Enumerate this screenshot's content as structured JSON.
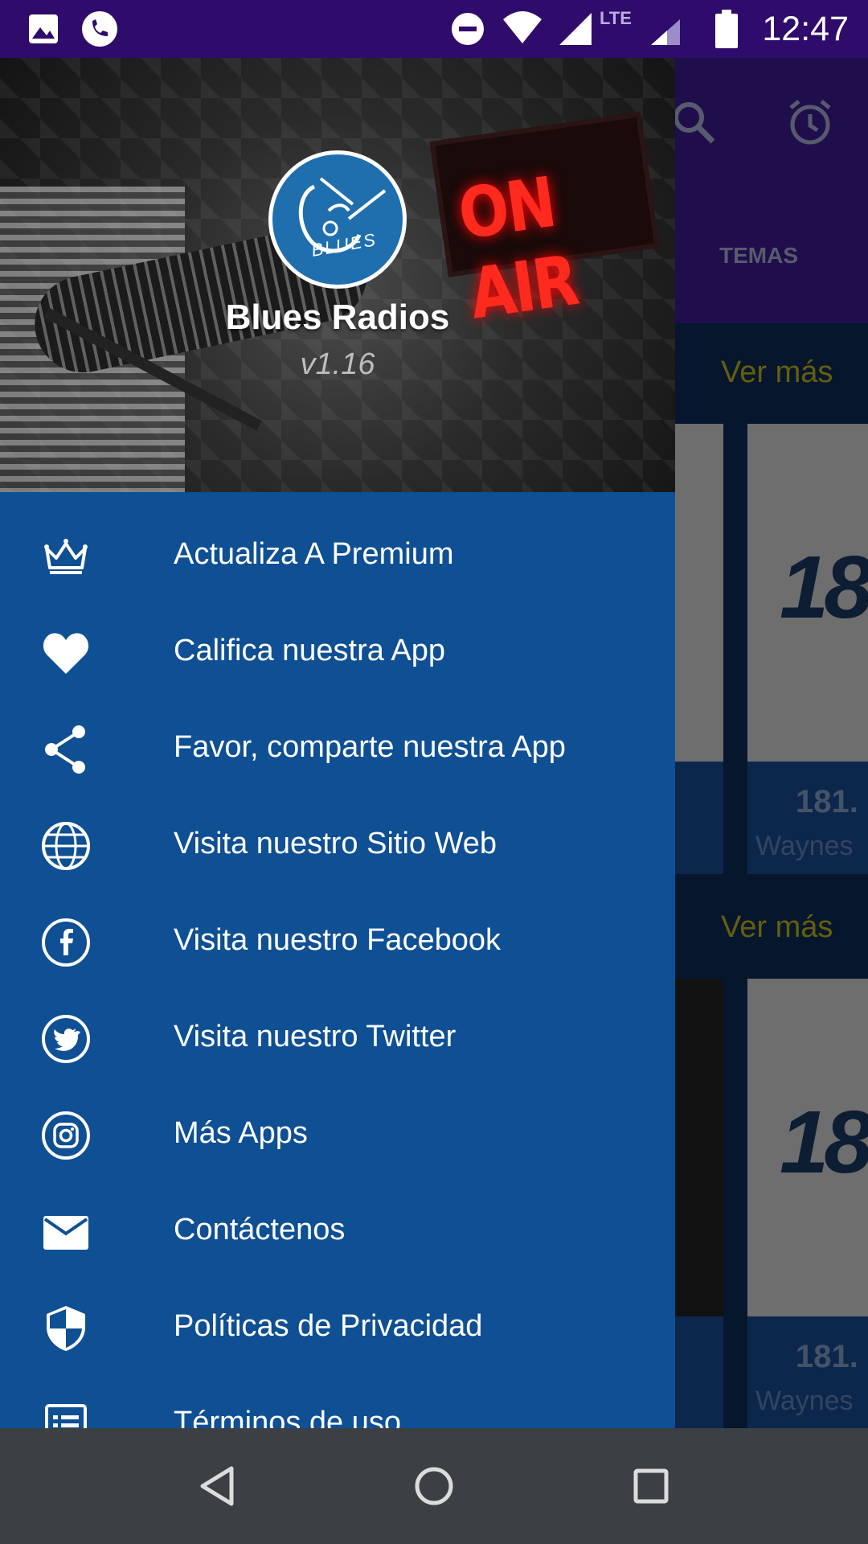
{
  "status_bar": {
    "time": "12:47",
    "network": "LTE",
    "icons": [
      "image-icon",
      "phone-icon",
      "do-not-disturb-icon",
      "wifi-icon",
      "signal-icon",
      "battery-icon"
    ]
  },
  "background_app": {
    "tab_label": "TEMAS",
    "sections": [
      {
        "link": "Ver más",
        "cards": [
          {
            "title": "181.",
            "subtitle": "Waynes"
          }
        ]
      },
      {
        "link": "Ver más",
        "cards": [
          {
            "title": "181.",
            "subtitle": "Waynes"
          }
        ]
      }
    ],
    "logo_text": "18",
    "accent_color": "#b8ac1a"
  },
  "drawer": {
    "header": {
      "on_air": "ON AIR",
      "logo_word": "BLUES",
      "app_name": "Blues Radios",
      "version": "v1.16"
    },
    "items": [
      {
        "label": "Actualiza A Premium",
        "icon": "crown-icon"
      },
      {
        "label": "Califica nuestra App",
        "icon": "heart-icon"
      },
      {
        "label": "Favor, comparte nuestra App",
        "icon": "share-icon"
      },
      {
        "label": "Visita nuestro Sitio Web",
        "icon": "globe-icon"
      },
      {
        "label": "Visita nuestro Facebook",
        "icon": "facebook-icon"
      },
      {
        "label": "Visita nuestro Twitter",
        "icon": "twitter-icon"
      },
      {
        "label": "Más Apps",
        "icon": "instagram-icon"
      },
      {
        "label": "Contáctenos",
        "icon": "mail-icon"
      },
      {
        "label": "Políticas de Privacidad",
        "icon": "shield-icon"
      },
      {
        "label": "Términos de uso",
        "icon": "document-list-icon"
      }
    ],
    "background_color": "#0f4f94"
  },
  "nav_bar": {
    "buttons": [
      "back-icon",
      "home-icon",
      "recents-icon"
    ]
  }
}
